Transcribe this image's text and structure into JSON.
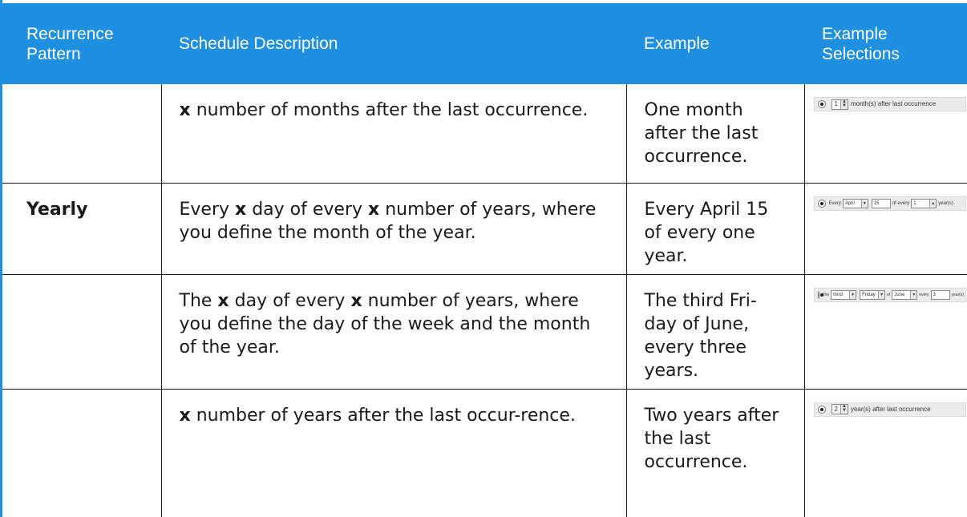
{
  "headers": [
    "Recurrence Pattern",
    "Schedule Description",
    "Example",
    "Example Selections"
  ],
  "rows": [
    {
      "pattern": "",
      "desc": [
        {
          "t": "x",
          "b": true
        },
        {
          "t": " number of months after the last occurrence."
        }
      ],
      "example": "One month after the last occurrence.",
      "selection": {
        "value": "1",
        "label": "month(s) after last occurrence"
      }
    },
    {
      "pattern": "Yearly",
      "desc": [
        {
          "t": "Every "
        },
        {
          "t": "x",
          "b": true
        },
        {
          "t": " day of every "
        },
        {
          "t": "x",
          "b": true
        },
        {
          "t": " number of years, where you define the month of the year."
        }
      ],
      "example": "Every April 15 of every one year.",
      "selection": {
        "every_label": "Every",
        "month": "April",
        "day": "15",
        "of_every": "of every",
        "years_value": "1",
        "years_label": "year(s)"
      }
    },
    {
      "pattern": "",
      "desc": [
        {
          "t": "The "
        },
        {
          "t": "x",
          "b": true
        },
        {
          "t": " day of every "
        },
        {
          "t": "x",
          "b": true
        },
        {
          "t": " number of years, where you define the day of the week and the month of the year."
        }
      ],
      "example": "The third Fri-day of June, every three years.",
      "selection": {
        "the": "The",
        "ordinal": "third",
        "weekday": "Friday",
        "of": "of",
        "month": "June",
        "every": "every",
        "years_value": "3",
        "years_label": "year(s)"
      }
    },
    {
      "pattern": "",
      "desc": [
        {
          "t": "x",
          "b": true
        },
        {
          "t": " number of years after the last occur-rence."
        }
      ],
      "example": "Two years after the last occurrence.",
      "selection": {
        "value": "2",
        "label": "year(s) after last occurrence"
      }
    }
  ]
}
